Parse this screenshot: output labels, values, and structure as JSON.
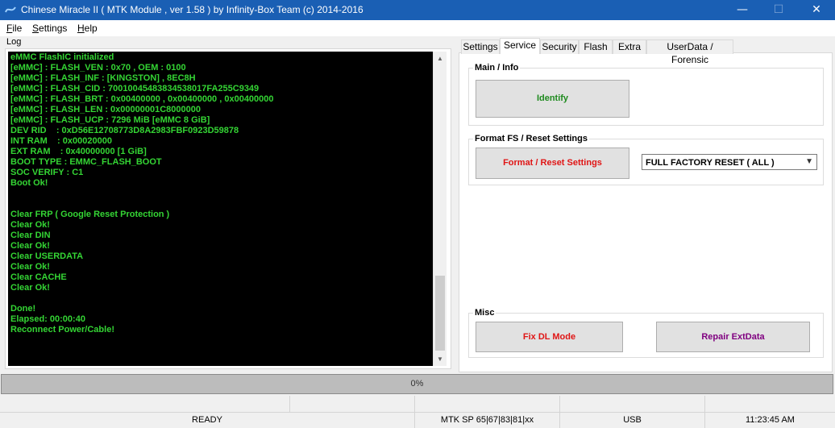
{
  "window": {
    "title": "Chinese Miracle II ( MTK Module , ver 1.58 ) by Infinity-Box Team (c) 2014-2016",
    "minimize": "—",
    "maximize": "☐",
    "close": "✕"
  },
  "menu": {
    "items": [
      {
        "hotkey": "F",
        "rest": "ile"
      },
      {
        "hotkey": "S",
        "rest": "ettings"
      },
      {
        "hotkey": "H",
        "rest": "elp"
      }
    ]
  },
  "log": {
    "label": "Log",
    "lines": [
      "eMMC FlashIC initialized",
      "[eMMC] : FLASH_VEN : 0x70 , OEM : 0100",
      "[eMMC] : FLASH_INF : [KINGSTON] , 8EC8H",
      "[eMMC] : FLASH_CID : 70010045483834538017FA255C9349",
      "[eMMC] : FLASH_BRT : 0x00400000 , 0x00400000 , 0x00400000",
      "[eMMC] : FLASH_LEN : 0x00000001C8000000",
      "[eMMC] : FLASH_UCP : 7296 MiB [eMMC 8 GiB]",
      "DEV RID    : 0xD56E12708773D8A2983FBF0923D59878",
      "INT RAM    : 0x00020000",
      "EXT RAM    : 0x40000000 [1 GiB]",
      "BOOT TYPE : EMMC_FLASH_BOOT",
      "SOC VERIFY : C1",
      "Boot Ok!",
      "",
      "",
      "Clear FRP ( Google Reset Protection )",
      "Clear Ok!",
      "Clear DIN",
      "Clear Ok!",
      "Clear USERDATA",
      "Clear Ok!",
      "Clear CACHE",
      "Clear Ok!",
      "",
      "Done!",
      "Elapsed: 00:00:40",
      "Reconnect Power/Cable!"
    ],
    "scroll_up": "▲",
    "scroll_down": "▼"
  },
  "tabs": [
    "Settings",
    "Service",
    "Security",
    "Flash",
    "Extra",
    "UserData / Forensic"
  ],
  "active_tab": "Service",
  "main_info": {
    "title": "Main / Info",
    "identify_label": "Identify",
    "identify_color": "#1e8a1e"
  },
  "format": {
    "title": "Format FS / Reset Settings",
    "button_label": "Format / Reset Settings",
    "button_color": "#e01515",
    "select_value": "FULL FACTORY RESET ( ALL )",
    "select_arrow": "▼"
  },
  "misc": {
    "title": "Misc",
    "fix_dl_label": "Fix DL Mode",
    "fix_dl_color": "#e01515",
    "repair_label": "Repair ExtData",
    "repair_color": "#800080"
  },
  "progress": {
    "text": "0%",
    "value": 0
  },
  "status": {
    "state": "READY",
    "platform": "MTK SP 65|67|83|81|xx",
    "connection": "USB",
    "time": "11:23:45 AM"
  },
  "colors": {
    "titlebar": "#1a5fb4",
    "log_text": "#34d534",
    "log_bg": "#000000"
  }
}
